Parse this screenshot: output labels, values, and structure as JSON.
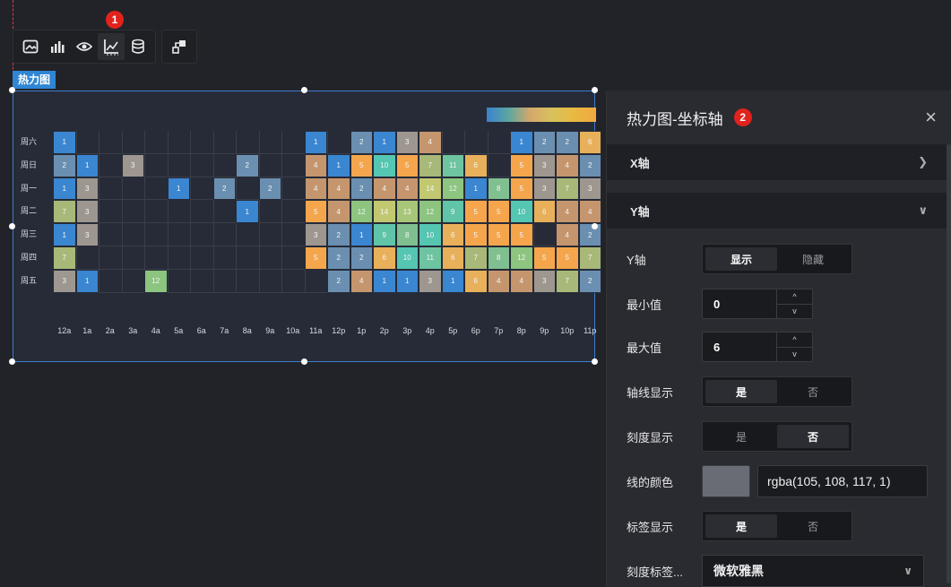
{
  "toolbar": {
    "icons": [
      "image-icon",
      "bar-chart-icon",
      "eye-icon",
      "axis-icon",
      "database-icon",
      "interaction-icon"
    ]
  },
  "badges": {
    "one": "1",
    "two": "2"
  },
  "component_tag": "热力图",
  "panel": {
    "title": "热力图-坐标轴",
    "close": "×",
    "x_section": "X轴",
    "y_section": "Y轴",
    "rows": {
      "y_axis": {
        "label": "Y轴",
        "on": "显示",
        "off": "隐藏"
      },
      "min": {
        "label": "最小值",
        "value": "0"
      },
      "max": {
        "label": "最大值",
        "value": "6"
      },
      "axis_line": {
        "label": "轴线显示",
        "on": "是",
        "off": "否"
      },
      "tick_show": {
        "label": "刻度显示",
        "on": "是",
        "off": "否"
      },
      "line_color": {
        "label": "线的颜色",
        "value": "rgba(105, 108, 117, 1)"
      },
      "label_show": {
        "label": "标签显示",
        "on": "是",
        "off": "否"
      },
      "tick_label_font": {
        "label": "刻度标签...",
        "value": "微软雅黑"
      }
    },
    "spin_up": "^",
    "spin_down": "v"
  },
  "chart_data": {
    "type": "heatmap",
    "x": [
      "12a",
      "1a",
      "2a",
      "3a",
      "4a",
      "5a",
      "6a",
      "7a",
      "8a",
      "9a",
      "10a",
      "11a",
      "12p",
      "1p",
      "2p",
      "3p",
      "4p",
      "5p",
      "6p",
      "7p",
      "8p",
      "9p",
      "10p",
      "11p"
    ],
    "y": [
      "周六",
      "周日",
      "周一",
      "周二",
      "周三",
      "周四",
      "周五"
    ],
    "colors": {
      "1": "#3a86d0",
      "2": "#6a8fb0",
      "3": "#9e9790",
      "4": "#c5966e",
      "5": "#f5a64c",
      "6": "#e8b05a",
      "7": "#a8b878",
      "8": "#80c090",
      "9": "#5fc4a8",
      "10": "#54c6b2",
      "11": "#6ec4a0",
      "12": "#8cc480",
      "13": "#a8c678",
      "14": "#c2c870"
    },
    "rows": [
      [
        "1",
        "",
        "",
        "",
        "",
        "",
        "",
        "",
        "",
        "",
        "",
        "1",
        "",
        "2",
        "1",
        "3",
        "4",
        "",
        "",
        "",
        "1",
        "2",
        "2",
        "6"
      ],
      [
        "2",
        "1",
        "",
        "3",
        "",
        "",
        "",
        "",
        "2",
        "",
        "",
        "4",
        "1",
        "5",
        "10",
        "5",
        "7",
        "11",
        "6",
        "",
        "5",
        "3",
        "4",
        "2"
      ],
      [
        "1",
        "3",
        "",
        "",
        "",
        "1",
        "",
        "2",
        "",
        "2",
        "",
        "4",
        "4",
        "2",
        "4",
        "4",
        "14",
        "12",
        "1",
        "8",
        "5",
        "3",
        "7",
        "3"
      ],
      [
        "7",
        "3",
        "",
        "",
        "",
        "",
        "",
        "",
        "1",
        "",
        "",
        "5",
        "4",
        "12",
        "14",
        "13",
        "12",
        "9",
        "5",
        "5",
        "10",
        "6",
        "4",
        "4"
      ],
      [
        "1",
        "3",
        "",
        "",
        "",
        "",
        "",
        "",
        "",
        "",
        "",
        "3",
        "2",
        "1",
        "9",
        "8",
        "10",
        "6",
        "5",
        "5",
        "5",
        "",
        "4",
        "2"
      ],
      [
        "7",
        "",
        "",
        "",
        "",
        "",
        "",
        "",
        "",
        "",
        "",
        "5",
        "2",
        "2",
        "6",
        "10",
        "11",
        "6",
        "7",
        "8",
        "12",
        "5",
        "5",
        "7"
      ],
      [
        "3",
        "1",
        "",
        "",
        "12",
        "",
        "",
        "",
        "",
        "",
        "",
        "",
        "2",
        "4",
        "1",
        "1",
        "3",
        "1",
        "6",
        "4",
        "4",
        "3",
        "7",
        "2"
      ]
    ]
  }
}
